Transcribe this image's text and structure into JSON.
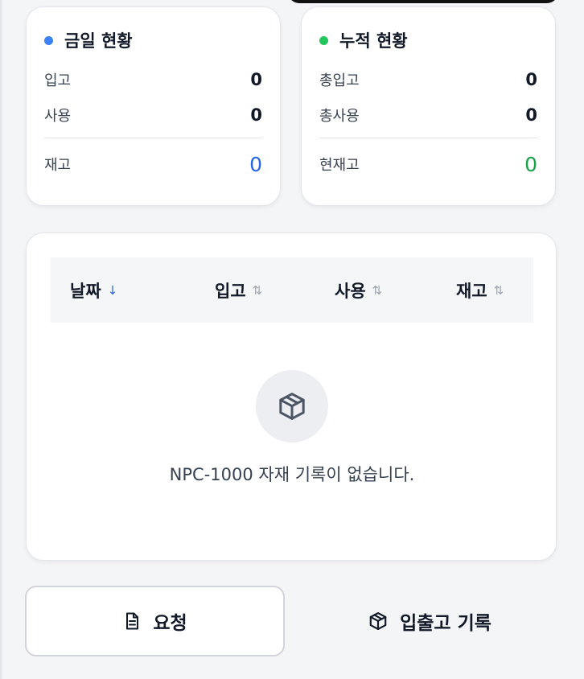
{
  "today": {
    "title": "금일 현황",
    "dot_color": "#3b82f6",
    "rows": [
      {
        "label": "입고",
        "value": "0"
      },
      {
        "label": "사용",
        "value": "0"
      }
    ],
    "total": {
      "label": "재고",
      "value": "0",
      "color": "#2563eb"
    }
  },
  "cumulative": {
    "title": "누적 현황",
    "dot_color": "#22c55e",
    "rows": [
      {
        "label": "총입고",
        "value": "0"
      },
      {
        "label": "총사용",
        "value": "0"
      }
    ],
    "total": {
      "label": "현재고",
      "value": "0",
      "color": "#16a34a"
    }
  },
  "table": {
    "columns": [
      {
        "label": "날짜",
        "sort_icon": "↓",
        "sort_state": "active-desc"
      },
      {
        "label": "입고",
        "sort_icon": "⇅",
        "sort_state": "none"
      },
      {
        "label": "사용",
        "sort_icon": "⇅",
        "sort_state": "none"
      },
      {
        "label": "재고",
        "sort_icon": "⇅",
        "sort_state": "none"
      }
    ],
    "empty_message": "NPC-1000 자재 기록이 없습니다.",
    "empty_icon": "package-icon"
  },
  "actions": {
    "request_label": "요청",
    "request_icon": "document-icon",
    "history_label": "입출고 기록",
    "history_icon": "package-icon"
  }
}
